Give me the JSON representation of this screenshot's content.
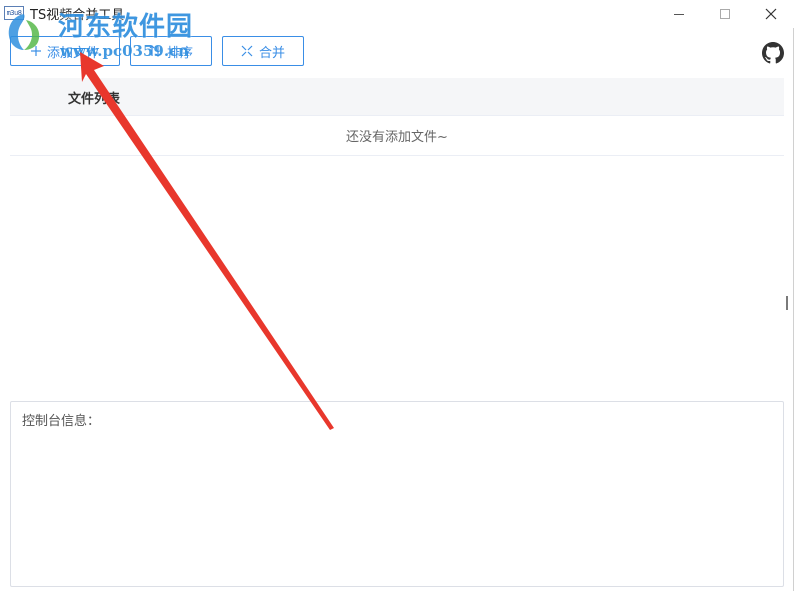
{
  "window": {
    "title": "TS视频合并工具",
    "app_icon_text": "m3u8",
    "controls": {
      "minimize_icon": "minimize-icon",
      "maximize_icon": "maximize-icon",
      "close_icon": "close-icon"
    }
  },
  "watermark": {
    "title": "河东软件园",
    "url": "www.pc0359.cn"
  },
  "toolbar": {
    "add_label": "添加文件",
    "sort_label": "排序",
    "merge_label": "合并",
    "github_icon": "github-icon"
  },
  "file_list": {
    "columns": [
      "文件列表"
    ],
    "rows": [],
    "empty_text": "还没有添加文件~"
  },
  "console": {
    "label": "控制台信息："
  },
  "colors": {
    "accent": "#3a8ee6",
    "header_bg": "#f5f6f8",
    "border": "#dcdfe6",
    "arrow": "#e8372c",
    "watermark": "#2f8fde"
  }
}
